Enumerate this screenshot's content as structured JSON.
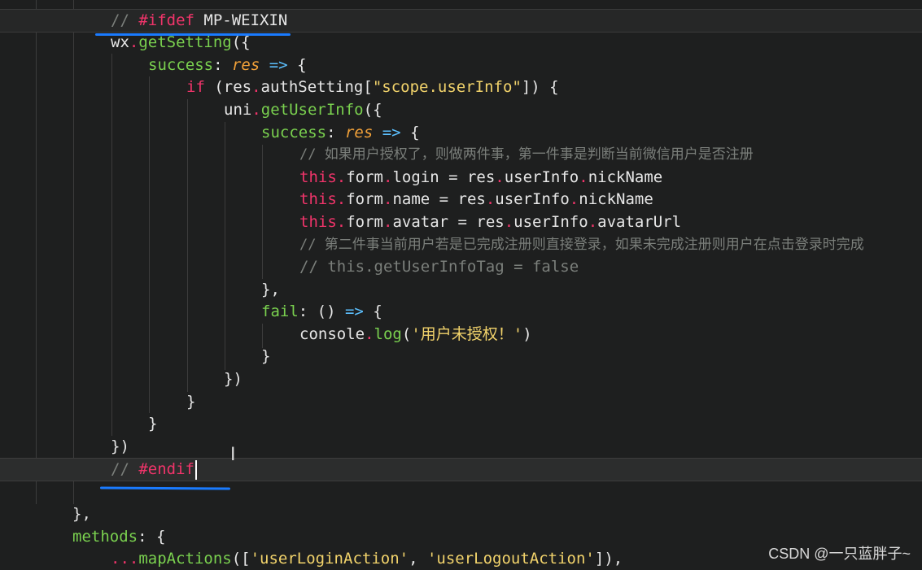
{
  "lines": [
    {
      "c1": "// ",
      "c2": "#ifdef",
      "c3": " MP-WEIXIN"
    },
    {
      "obj": "wx",
      "dot": ".",
      "fn": "getSetting",
      "rest": "({"
    },
    {
      "key": "success",
      "colon": ": ",
      "param": "res",
      "arrow": " => ",
      "rest": "{"
    },
    {
      "kw": "if",
      "a": " (res",
      "dot": ".",
      "b": "authSetting[",
      "str": "\"scope.userInfo\"",
      "c": "]) {"
    },
    {
      "obj": "uni",
      "dot": ".",
      "fn": "getUserInfo",
      "rest": "({"
    },
    {
      "key": "success",
      "colon": ": ",
      "param": "res",
      "arrow": " => ",
      "rest": "{"
    },
    {
      "text": "// 如果用户授权了，则做两件事，第一件事是判断当前微信用户是否注册"
    },
    {
      "kw": "this",
      "d1": ".",
      "a": "form",
      "d2": ".",
      "b": "login = res",
      "d3": ".",
      "c": "userInfo",
      "d4": ".",
      "e": "nickName"
    },
    {
      "kw": "this",
      "d1": ".",
      "a": "form",
      "d2": ".",
      "b": "name = res",
      "d3": ".",
      "c": "userInfo",
      "d4": ".",
      "e": "nickName"
    },
    {
      "kw": "this",
      "d1": ".",
      "a": "form",
      "d2": ".",
      "b": "avatar = res",
      "d3": ".",
      "c": "userInfo",
      "d4": ".",
      "e": "avatarUrl"
    },
    {
      "text": "// 第二件事当前用户若是已完成注册则直接登录，如果未完成注册则用户在点击登录时完成"
    },
    {
      "text": "// this.getUserInfoTag = false"
    },
    {
      "text": "},"
    },
    {
      "key": "fail",
      "colon": ": ",
      "a": "() ",
      "arrow": "=>",
      "rest": " {"
    },
    {
      "obj": "console",
      "dot": ".",
      "fn": "log",
      "a": "(",
      "str": "'用户未授权！'",
      "b": ")"
    },
    {
      "text": "}"
    },
    {
      "text": "})"
    },
    {
      "text": "}"
    },
    {
      "text": "}"
    },
    {
      "text": "})"
    },
    {
      "c1": "// ",
      "c2": "#endif"
    },
    {
      "text": ""
    },
    {
      "text": "},"
    },
    {
      "key": "methods",
      "rest": ": {"
    },
    {
      "spread": "...",
      "fn": "mapActions",
      "a": "([",
      "s1": "'userLoginAction'",
      "b": ", ",
      "s2": "'userLogoutAction'",
      "c": "]),"
    }
  ],
  "watermark": "CSDN @一只蓝胖子~"
}
